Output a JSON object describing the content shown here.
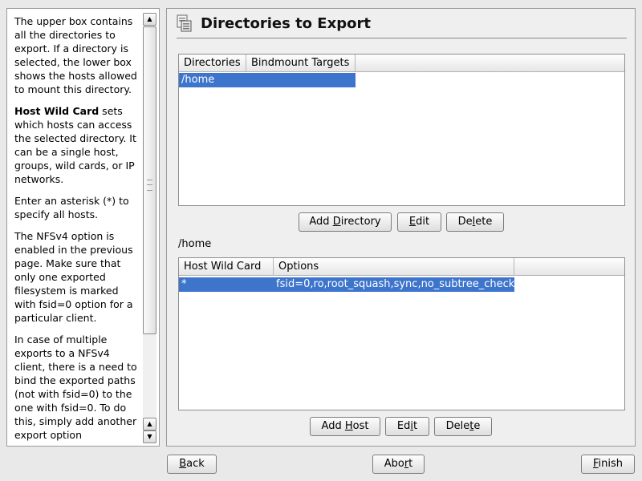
{
  "help": {
    "p1": "The upper box contains all the directories to export. If a directory is selected, the lower box shows the hosts allowed to mount this directory.",
    "p2_bold": "Host Wild Card",
    "p2_rest": " sets which hosts can access the selected directory. It can be a single host, groups, wild cards, or IP networks.",
    "p3": "Enter an asterisk (*) to specify all hosts.",
    "p4": "The NFSv4 option is enabled in the previous page. Make sure that only one exported filesystem is marked with fsid=0 option for a particular client.",
    "p5": "In case of multiple exports to a NFSv4 client, there is a need to bind the exported paths (not with fsid=0) to the one with fsid=0. To do this, simply add another export option"
  },
  "page": {
    "title": "Directories to Export",
    "icon": "export-folder-icon"
  },
  "directories": {
    "columns": [
      "Directories",
      "Bindmount Targets"
    ],
    "rows": [
      {
        "directory": "/home",
        "bindmount": ""
      }
    ]
  },
  "dir_buttons": {
    "add": {
      "pre": "Add ",
      "key": "D",
      "post": "irectory"
    },
    "edit": {
      "pre": "",
      "key": "E",
      "post": "dit"
    },
    "delete": {
      "pre": "De",
      "key": "l",
      "post": "ete"
    }
  },
  "selected_directory": "/home",
  "hosts": {
    "columns": [
      "Host Wild Card",
      "Options"
    ],
    "rows": [
      {
        "host": "*",
        "options": "fsid=0,ro,root_squash,sync,no_subtree_check"
      }
    ]
  },
  "host_buttons": {
    "add": {
      "pre": "Add ",
      "key": "H",
      "post": "ost"
    },
    "edit": {
      "pre": "Ed",
      "key": "i",
      "post": "t"
    },
    "delete": {
      "pre": "Dele",
      "key": "t",
      "post": "e"
    }
  },
  "nav": {
    "back": {
      "pre": "",
      "key": "B",
      "post": "ack"
    },
    "abort": {
      "pre": "Abo",
      "key": "r",
      "post": "t"
    },
    "finish": {
      "pre": "",
      "key": "F",
      "post": "inish"
    }
  },
  "colors": {
    "selection": "#3d74cc",
    "selection_text": "#ffffff"
  }
}
